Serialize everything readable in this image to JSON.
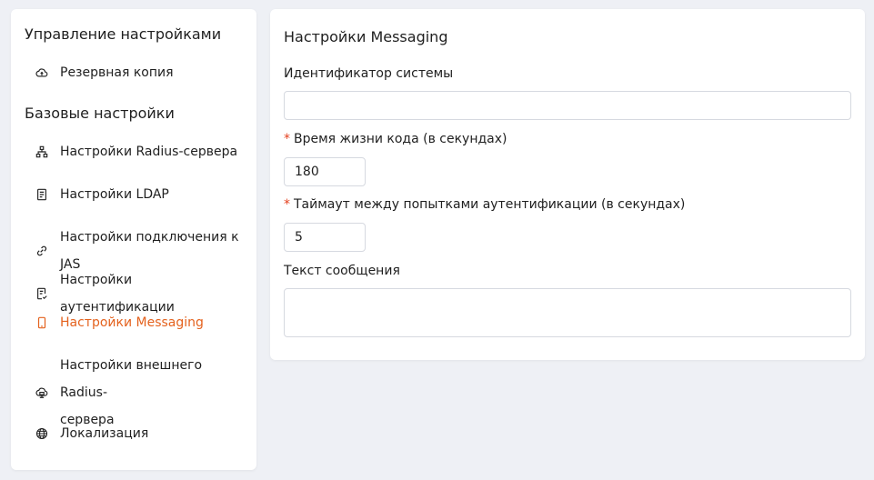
{
  "sidebar": {
    "section_management": "Управление настройками",
    "section_basic": "Базовые настройки",
    "items": [
      {
        "label": "Резервная копия",
        "icon": "cloud-backup-icon"
      },
      {
        "label": "Настройки Radius-сервера",
        "icon": "sitemap-icon"
      },
      {
        "label": "Настройки LDAP",
        "icon": "document-list-icon"
      },
      {
        "label": "Настройки подключения к JAS",
        "icon": "link-icon"
      },
      {
        "label": "Настройки аутентификации",
        "icon": "document-check-icon"
      },
      {
        "label": "Настройки Messaging",
        "icon": "mobile-phone-icon"
      },
      {
        "label": "Настройки внешнего Radius-",
        "label2": "сервера",
        "icon": "cloud-server-icon"
      },
      {
        "label": "Локализация",
        "icon": "globe-icon"
      }
    ],
    "active_color": "#e4621e"
  },
  "main": {
    "title": "Настройки Messaging",
    "fields": {
      "system_id": {
        "label": "Идентификатор системы",
        "value": ""
      },
      "code_ttl": {
        "required_mark": "*",
        "label": "Время жизни кода (в секундах)",
        "value": "180"
      },
      "auth_timeout": {
        "required_mark": "*",
        "label": "Таймаут между попытками аутентификации (в секундах)",
        "value": "5"
      },
      "message_text": {
        "label": "Текст сообщения",
        "value": ""
      }
    }
  }
}
